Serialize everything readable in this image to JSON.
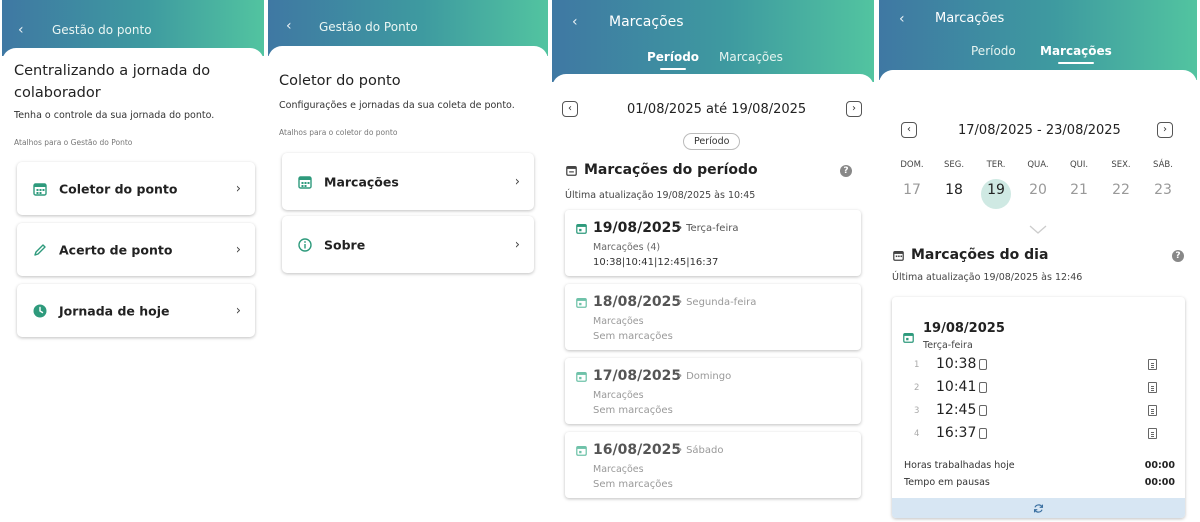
{
  "screen1": {
    "header_title": "Gestão do ponto",
    "title_line1": "Centralizando a jornada do",
    "title_line2": "colaborador",
    "subtitle": "Tenha o controle da sua jornada do ponto.",
    "shortcuts_label": "Atalhos para o Gestão do Ponto",
    "items": [
      {
        "label": "Coletor do ponto",
        "icon": "calendar-icon"
      },
      {
        "label": "Acerto de ponto",
        "icon": "pencil-icon"
      },
      {
        "label": "Jornada de hoje",
        "icon": "clock-icon"
      }
    ]
  },
  "screen2": {
    "header_title": "Gestão do Ponto",
    "title": "Coletor do ponto",
    "subtitle": "Configurações e jornadas da sua coleta de ponto.",
    "shortcuts_label": "Atalhos para o coletor do ponto",
    "items": [
      {
        "label": "Marcações",
        "icon": "calendar-icon"
      },
      {
        "label": "Sobre",
        "icon": "info-icon"
      }
    ]
  },
  "screen3": {
    "header_title": "Marcações",
    "tabs": [
      "Período",
      "Marcações"
    ],
    "range": "01/08/2025 até 19/08/2025",
    "period_button": "Período",
    "section_title": "Marcações do período",
    "last_update": "Última atualização 19/08/2025 às 10:45",
    "days": [
      {
        "date": "19/08/2025",
        "weekday": "Terça-feira",
        "line1": "Marcações (4)",
        "line2": "10:38|10:41|12:45|16:37"
      },
      {
        "date": "18/08/2025",
        "weekday": "Segunda-feira",
        "line1": "Marcações",
        "line2": "Sem marcações"
      },
      {
        "date": "17/08/2025",
        "weekday": "Domingo",
        "line1": "Marcações",
        "line2": "Sem marcações"
      },
      {
        "date": "16/08/2025",
        "weekday": "Sábado",
        "line1": "Marcações",
        "line2": "Sem marcações"
      }
    ]
  },
  "screen4": {
    "header_title": "Marcações",
    "tabs": [
      "Período",
      "Marcações"
    ],
    "week_range": "17/08/2025 - 23/08/2025",
    "weekday_names": [
      "DOM.",
      "SEG.",
      "TER.",
      "QUA.",
      "QUI.",
      "SEX.",
      "SÁB."
    ],
    "week_days": [
      "17",
      "18",
      "19",
      "20",
      "21",
      "22",
      "23"
    ],
    "section_title": "Marcações do dia",
    "last_update": "Última atualização 19/08/2025 às 12:46",
    "day_date": "19/08/2025",
    "day_weekday": "Terça-feira",
    "punches": [
      {
        "index": "1",
        "time": "10:38"
      },
      {
        "index": "2",
        "time": "10:41"
      },
      {
        "index": "3",
        "time": "12:45"
      },
      {
        "index": "4",
        "time": "16:37"
      }
    ],
    "worked_label": "Horas trabalhadas hoje",
    "worked_value": "00:00",
    "pause_label": "Tempo em pausas",
    "pause_value": "00:00"
  },
  "colors": {
    "accent": "#2e9a7c",
    "header_start": "#3f78a3",
    "header_end": "#52c4a0",
    "selected_day": "#cfe9e3"
  }
}
